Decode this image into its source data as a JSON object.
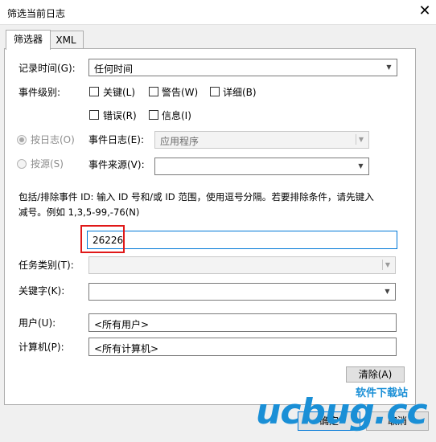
{
  "window": {
    "title": "筛选当前日志",
    "close_glyph": "✕"
  },
  "tabs": [
    {
      "label": "筛选器"
    },
    {
      "label": "XML"
    }
  ],
  "filter": {
    "logged_label": "记录时间(G):",
    "logged_value": "任何时间",
    "level_label": "事件级别:",
    "levels": [
      {
        "label": "关键(L)"
      },
      {
        "label": "警告(W)"
      },
      {
        "label": "详细(B)"
      },
      {
        "label": "错误(R)"
      },
      {
        "label": "信息(I)"
      }
    ],
    "by_log_label": "按日志(O)",
    "by_source_label": "按源(S)",
    "event_logs_label": "事件日志(E):",
    "event_logs_value": "应用程序",
    "event_sources_label": "事件来源(V):",
    "event_sources_value": "",
    "id_hint_line1": "包括/排除事件 ID: 输入 ID 号和/或 ID 范围，使用逗号分隔。若要排除条件，请先键入",
    "id_hint_line2": "减号。例如 1,3,5-99,-76(N)",
    "event_id_value": "26226",
    "task_category_label": "任务类别(T):",
    "keywords_label": "关键字(K):",
    "user_label": "用户(U):",
    "user_value": "<所有用户>",
    "computer_label": "计算机(P):",
    "computer_value": "<所有计算机>",
    "clear_label": "清除(A)",
    "ok_label": "确定",
    "cancel_label": "取消"
  },
  "watermark": {
    "text": "ucbug.cc",
    "sub": "软件下载站"
  },
  "colors": {
    "highlight": "#e01818",
    "watermark_blue": "#1a8fd6",
    "watermark_orange": "#f07a10"
  }
}
